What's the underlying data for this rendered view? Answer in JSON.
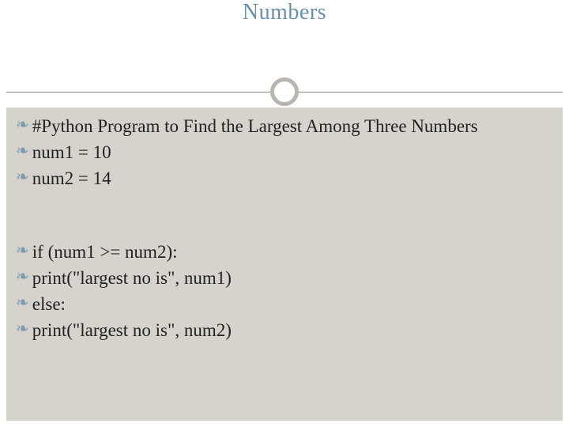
{
  "title": "Numbers",
  "bullet_char": "❧",
  "lines": {
    "comment": "#Python Program to Find the Largest Among Three Numbers",
    "num1": "num1 = 10",
    "num2": "num2 = 14",
    "ifline": "if (num1 >= num2):",
    "print1": "   print(\"largest no is\", num1)",
    "elseline": "else:",
    "print2": "   print(\"largest no is\", num2)"
  }
}
